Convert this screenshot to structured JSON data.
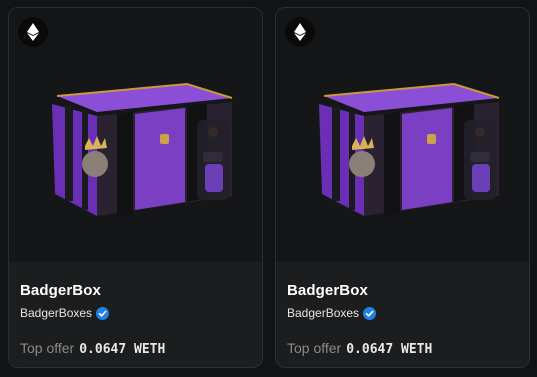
{
  "cards": [
    {
      "name": "BadgerBox",
      "collection": "BadgerBoxes",
      "verified_icon": "verified-badge-icon",
      "chain_icon": "ethereum-icon",
      "offer_label": "Top offer",
      "offer_value": "0.0647 WETH"
    },
    {
      "name": "BadgerBox",
      "collection": "BadgerBoxes",
      "verified_icon": "verified-badge-icon",
      "chain_icon": "ethereum-icon",
      "offer_label": "Top offer",
      "offer_value": "0.0647 WETH"
    }
  ],
  "colors": {
    "card_bg": "#1c1d1f",
    "verified": "#2081e2",
    "box_purple": "#7b3fc4"
  }
}
